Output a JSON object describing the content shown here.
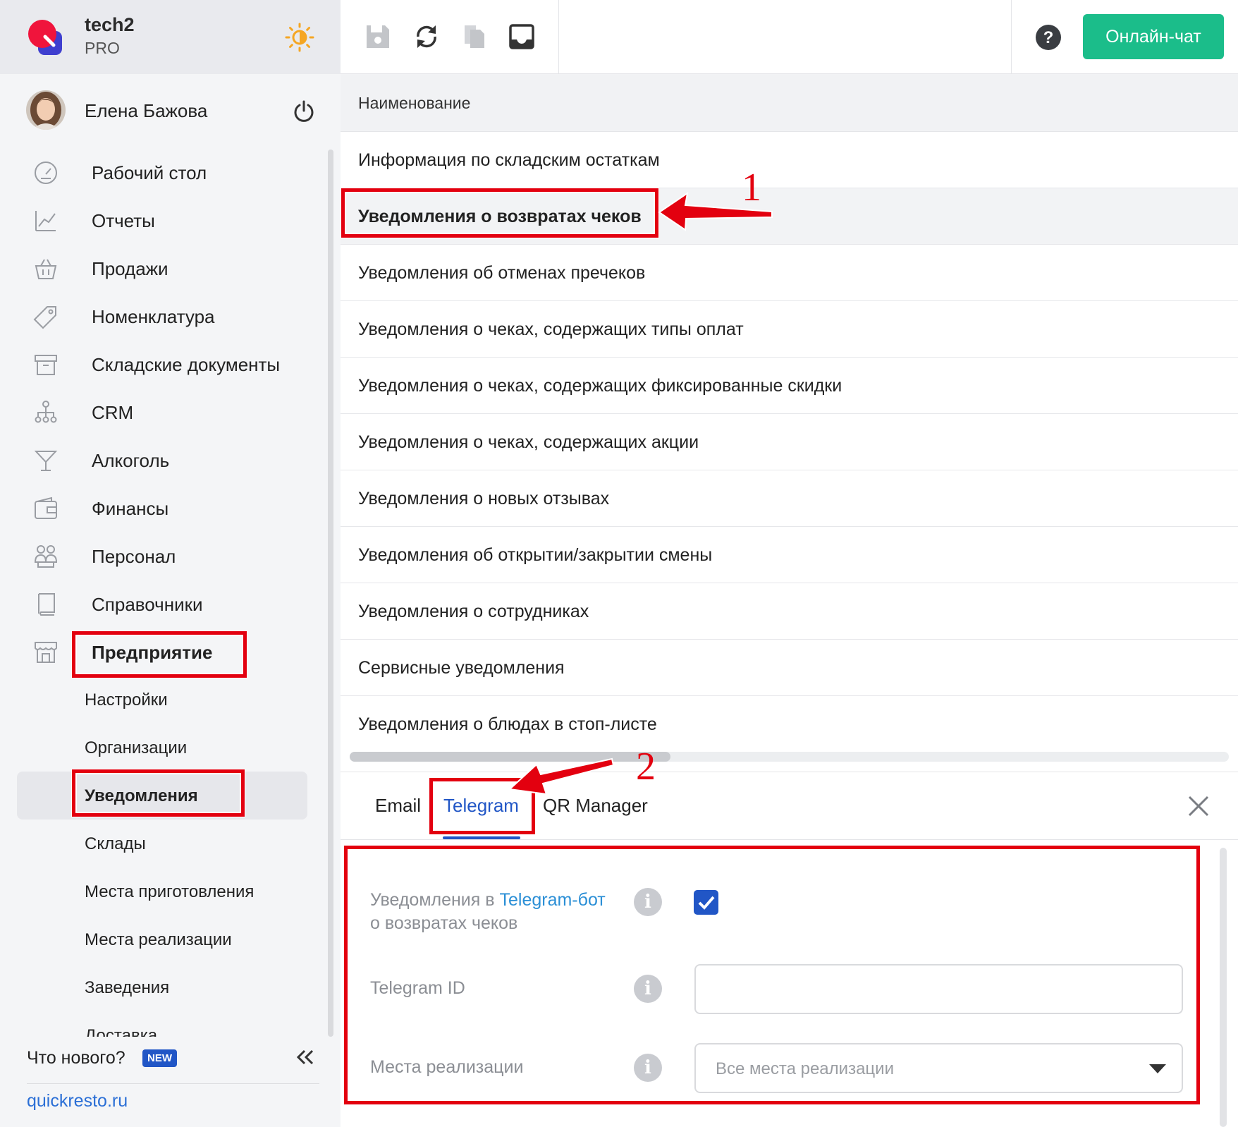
{
  "brand": {
    "name": "tech2",
    "plan": "PRO"
  },
  "user": {
    "name": "Елена Бажова"
  },
  "nav": {
    "items": [
      {
        "label": "Рабочий стол",
        "icon": "dashboard-icon"
      },
      {
        "label": "Отчеты",
        "icon": "chart-icon"
      },
      {
        "label": "Продажи",
        "icon": "basket-icon"
      },
      {
        "label": "Номенклатура",
        "icon": "tag-icon"
      },
      {
        "label": "Складские документы",
        "icon": "archive-icon"
      },
      {
        "label": "CRM",
        "icon": "org-icon"
      },
      {
        "label": "Алкоголь",
        "icon": "cocktail-icon"
      },
      {
        "label": "Финансы",
        "icon": "wallet-icon"
      },
      {
        "label": "Персонал",
        "icon": "people-icon"
      },
      {
        "label": "Справочники",
        "icon": "book-icon"
      },
      {
        "label": "Предприятие",
        "icon": "store-icon"
      }
    ],
    "sub_items": [
      {
        "label": "Настройки"
      },
      {
        "label": "Организации"
      },
      {
        "label": "Уведомления"
      },
      {
        "label": "Склады"
      },
      {
        "label": "Места приготовления"
      },
      {
        "label": "Места реализации"
      },
      {
        "label": "Заведения"
      },
      {
        "label": "Доставка"
      }
    ],
    "active_sub": "Уведомления"
  },
  "sidebar_footer": {
    "whats_new": "Что нового?",
    "badge": "NEW",
    "site": "quickresto.ru"
  },
  "toolbar": {
    "chat_label": "Онлайн-чат"
  },
  "list": {
    "header": "Наименование",
    "rows": [
      "Информация по складским остаткам",
      "Уведомления о возвратах чеков",
      "Уведомления об отменах пречеков",
      "Уведомления о чеках, содержащих типы оплат",
      "Уведомления о чеках, содержащих фиксированные скидки",
      "Уведомления о чеках, содержащих акции",
      "Уведомления о новых отзывах",
      "Уведомления об открытии/закрытии смены",
      "Уведомления о сотрудниках",
      "Сервисные уведомления",
      "Уведомления о блюдах в стоп-листе"
    ],
    "selected_row": "Уведомления о возвратах чеков"
  },
  "tabs": {
    "email": "Email",
    "telegram": "Telegram",
    "qr": "QR Manager",
    "active": "Telegram"
  },
  "form": {
    "bot_label_prefix": "Уведомления в ",
    "bot_label_link": "Telegram-бот",
    "bot_label_suffix": "о возвратах чеков",
    "bot_enabled": true,
    "telegram_id_label": "Telegram ID",
    "telegram_id_value": "",
    "places_label": "Места реализации",
    "places_value": "Все места реализации"
  },
  "annotations": {
    "one": "1",
    "two": "2"
  },
  "colors": {
    "accent": "#2156c6",
    "chat": "#1bbd8a",
    "annotation": "#e3000f",
    "theme": "#f5a623"
  }
}
